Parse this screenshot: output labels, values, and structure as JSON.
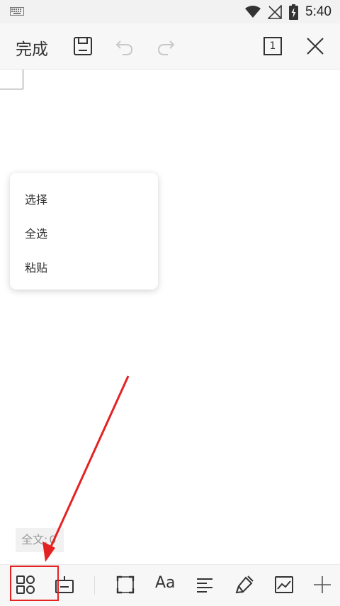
{
  "status_bar": {
    "time": "5:40",
    "icons": [
      "keyboard-icon",
      "wifi-icon",
      "no-signal-icon",
      "battery-charging-icon"
    ]
  },
  "toolbar": {
    "done_label": "完成",
    "page_number": "1",
    "icons": [
      "save-icon",
      "undo-icon",
      "redo-icon",
      "page-view-icon",
      "close-icon"
    ]
  },
  "context_menu": {
    "items": [
      {
        "label": "选择"
      },
      {
        "label": "全选"
      },
      {
        "label": "粘贴"
      }
    ]
  },
  "word_count": {
    "label": "全文:",
    "value": "0"
  },
  "bottom_toolbar": {
    "icons": [
      "apps-grid-icon",
      "keyboard-hide-icon",
      "fullscreen-icon",
      "font-icon",
      "align-left-icon",
      "format-paint-icon",
      "image-icon",
      "insert-icon"
    ],
    "font_icon_text": "Aa"
  },
  "annotation": {
    "color": "#e52222"
  }
}
